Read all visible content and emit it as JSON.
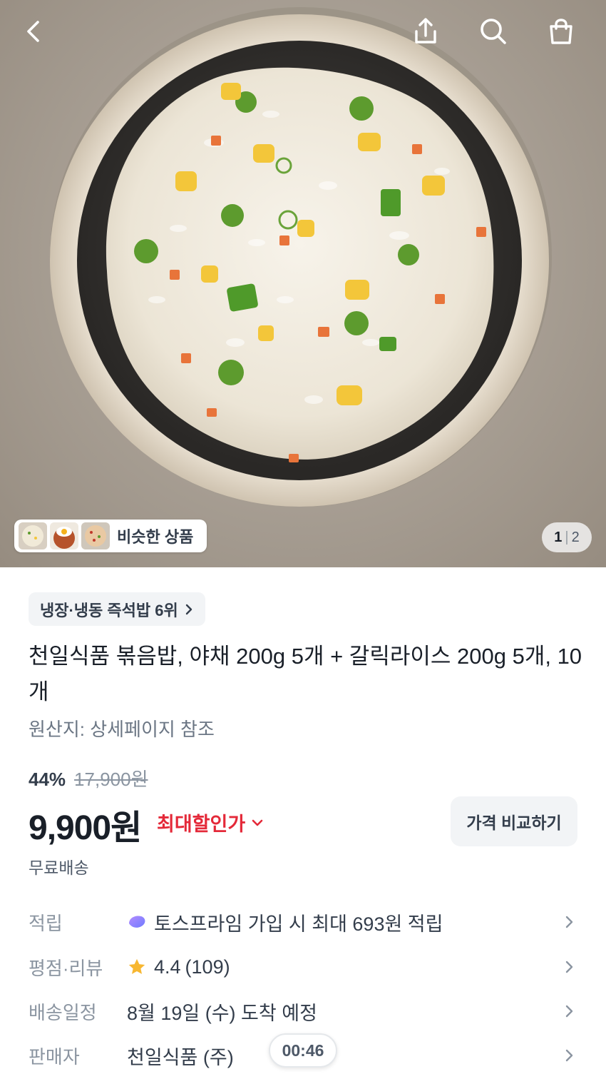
{
  "header": {
    "back_icon": "chevron-left-icon",
    "share_icon": "share-upload-icon",
    "search_icon": "search-icon",
    "cart_icon": "shopping-bag-icon"
  },
  "gallery": {
    "similar_label": "비슷한 상품",
    "page_current": "1",
    "page_separator": "|",
    "page_total": "2"
  },
  "product": {
    "rank_chip": "냉장·냉동 즉석밥 6위",
    "title": "천일식품 볶음밥, 야채 200g 5개 + 갈릭라이스 200g 5개, 10개",
    "origin": "원산지: 상세페이지 참조",
    "discount_percent": "44%",
    "original_price": "17,900원",
    "price": "9,900원",
    "max_discount_label": "최대할인가",
    "compare_button": "가격 비교하기",
    "shipping": "무료배송"
  },
  "info_rows": {
    "points": {
      "label": "적립",
      "value": "토스프라임 가입 시 최대 693원 적립"
    },
    "rating": {
      "label": "평점·리뷰",
      "score": "4.4",
      "count": "(109)"
    },
    "delivery": {
      "label": "배송일정",
      "value": "8월 19일 (수) 도착 예정"
    },
    "seller": {
      "label": "판매자",
      "value": "천일식품 (주)"
    }
  },
  "timer": "00:46",
  "colors": {
    "accent_red": "#e42939",
    "star": "#f7b731",
    "chip_bg": "#f2f4f6"
  }
}
